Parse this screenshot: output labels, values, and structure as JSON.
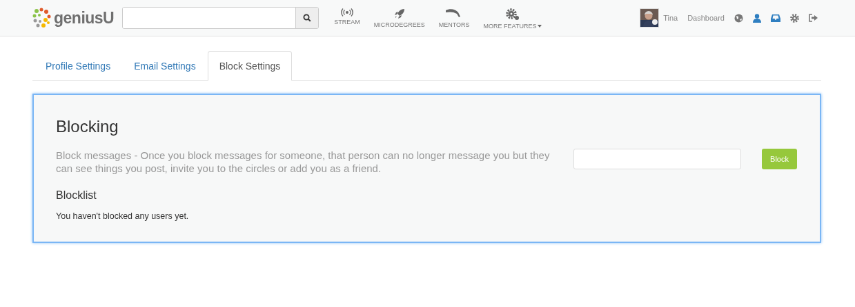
{
  "header": {
    "logo": "geniusU",
    "nav": [
      {
        "kind": "stream",
        "label": "STREAM",
        "dropdown": false
      },
      {
        "kind": "rocket",
        "label": "MICRODEGREES",
        "dropdown": false
      },
      {
        "kind": "mentor",
        "label": "MENTORS",
        "dropdown": false
      },
      {
        "kind": "gears",
        "label": "MORE FEATURES",
        "dropdown": true
      }
    ],
    "user": {
      "name": "Tina"
    },
    "dashboard": "Dashboard",
    "icons": [
      {
        "kind": "globe",
        "highlighted": false
      },
      {
        "kind": "user",
        "highlighted": true
      },
      {
        "kind": "inbox",
        "highlighted": true
      },
      {
        "kind": "settings",
        "highlighted": false
      },
      {
        "kind": "logout",
        "highlighted": false
      }
    ]
  },
  "tabs": [
    {
      "label": "Profile Settings",
      "selected": false
    },
    {
      "label": "Email Settings",
      "selected": false
    },
    {
      "label": "Block Settings",
      "selected": true
    }
  ],
  "panel": {
    "title": "Blocking",
    "description": "Block messages - Once you block messages for someone, that person can no longer message you but they can see things you post, invite you to the circles or add you as a friend.",
    "button": "Block",
    "list_title": "Blocklist",
    "empty_message": "You haven't blocked any users yet."
  }
}
